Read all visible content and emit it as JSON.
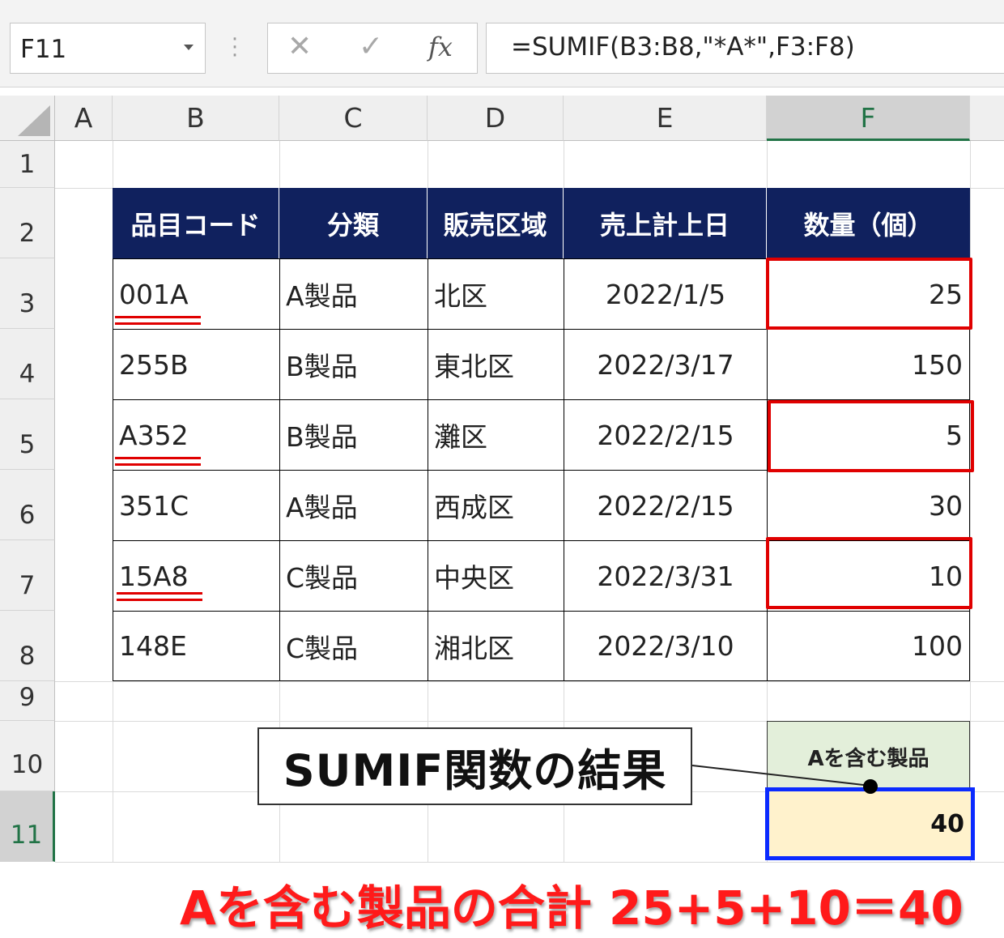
{
  "formula_bar": {
    "name_box": "F11",
    "cancel_icon": "✕",
    "enter_icon": "✓",
    "fx_icon": "fx",
    "formula": "=SUMIF(B3:B8,\"*A*\",F3:F8)"
  },
  "columns": [
    "A",
    "B",
    "C",
    "D",
    "E",
    "F"
  ],
  "rows": [
    "1",
    "2",
    "3",
    "4",
    "5",
    "6",
    "7",
    "8",
    "9",
    "10",
    "11"
  ],
  "table": {
    "headers": [
      "品目コード",
      "分類",
      "販売区域",
      "売上計上日",
      "数量（個）"
    ],
    "rows": [
      {
        "code": "001A",
        "category": "A製品",
        "region": "北区",
        "date": "2022/1/5",
        "qty": "25"
      },
      {
        "code": "255B",
        "category": "B製品",
        "region": "東北区",
        "date": "2022/3/17",
        "qty": "150"
      },
      {
        "code": "A352",
        "category": "B製品",
        "region": "灘区",
        "date": "2022/2/15",
        "qty": "5"
      },
      {
        "code": "351C",
        "category": "A製品",
        "region": "西成区",
        "date": "2022/2/15",
        "qty": "30"
      },
      {
        "code": "15A8",
        "category": "C製品",
        "region": "中央区",
        "date": "2022/3/31",
        "qty": "10"
      },
      {
        "code": "148E",
        "category": "C製品",
        "region": "湘北区",
        "date": "2022/3/10",
        "qty": "100"
      }
    ]
  },
  "result": {
    "label": "Aを含む製品",
    "value": "40"
  },
  "callout_text": "SUMIF関数の結果",
  "note": {
    "left": "Aを含む製品の合計",
    "right": "25+5+10＝40"
  },
  "colors": {
    "header_bg": "#10215e",
    "highlight_red": "#e00000",
    "result_border": "#0b2bff",
    "label_bg": "#e3efda",
    "result_bg": "#fff2cc",
    "selected_green": "#217346"
  }
}
